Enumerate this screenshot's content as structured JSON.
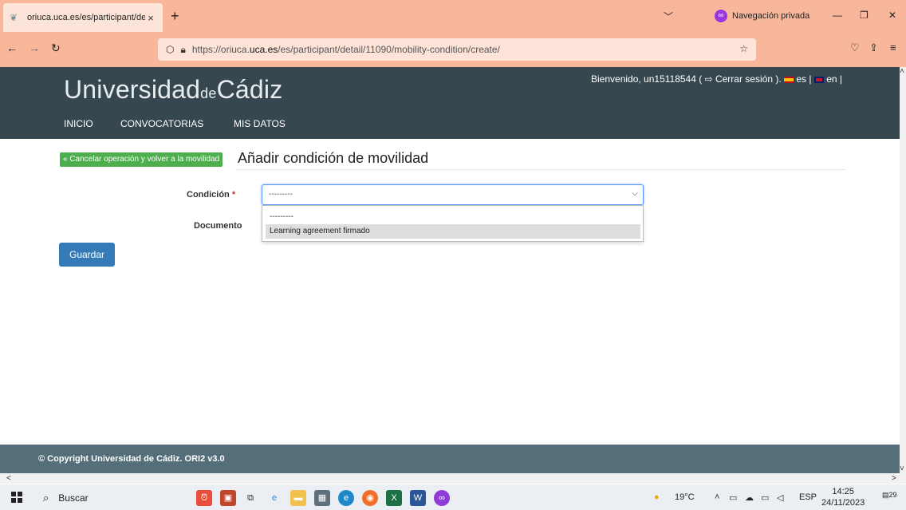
{
  "browser": {
    "tab_title": "oriuca.uca.es/es/participant/det",
    "tab_close": "×",
    "new_tab": "+",
    "private_label": "Navegación privada",
    "url_prefix": "https://oriuca.",
    "url_domain": "uca.es",
    "url_suffix": "/es/participant/detail/11090/mobility-condition/create/"
  },
  "site": {
    "logo_main": "Universidad",
    "logo_de": "de",
    "logo_city": "Cádiz",
    "welcome_prefix": "Bienvenido, un15118544 ( ",
    "logout_label": "Cerrar sesión",
    "welcome_suffix": " ).",
    "lang_es": "es",
    "lang_en": "en",
    "nav": [
      "INICIO",
      "CONVOCATORIAS",
      "MIS DATOS"
    ]
  },
  "page": {
    "cancel_label": "« Cancelar operación y volver a la movilidad",
    "title": "Añadir condición de movilidad",
    "condition_label": "Condición",
    "required_mark": "*",
    "document_label": "Documento",
    "select_value": "---------",
    "options": [
      "---------",
      "Learning agreement firmado"
    ],
    "save_label": "Guardar"
  },
  "footer": {
    "copyright": "© Copyright Universidad de Cádiz. ORI2 v3.0"
  },
  "taskbar": {
    "search_label": "Buscar",
    "temperature": "19°C",
    "language": "ESP",
    "time": "14:25",
    "date": "24/11/2023",
    "notifications": "29"
  },
  "colors": {
    "browser_chrome": "#f8b79a",
    "site_header": "#37474f",
    "cancel_button": "#4cae4c",
    "save_button": "#337ab7",
    "footer": "#546e7a"
  }
}
